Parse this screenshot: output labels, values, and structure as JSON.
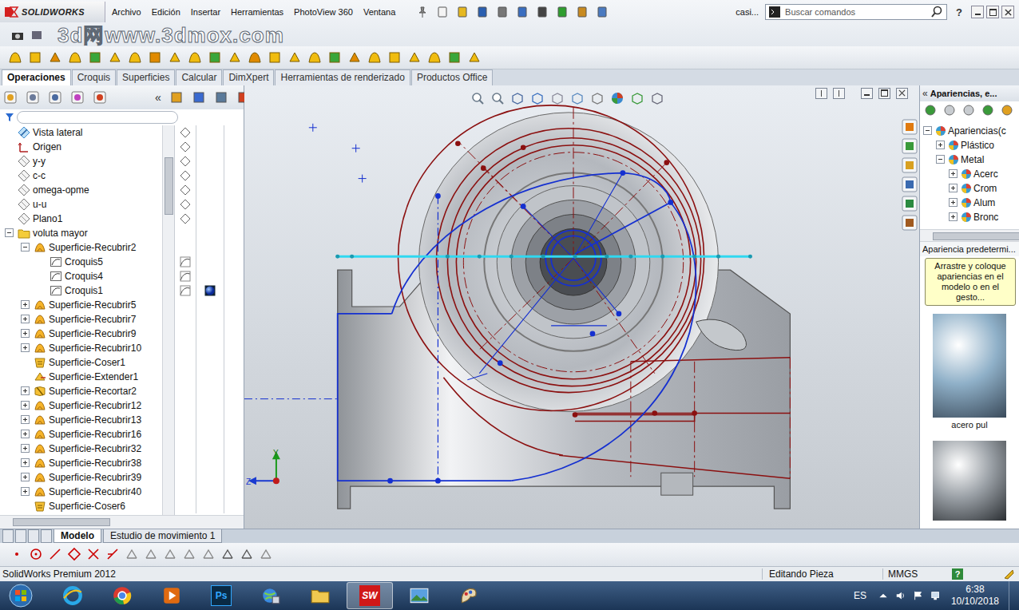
{
  "watermark": "3d网www.3dmox.com",
  "app": {
    "logo": "SOLIDWORKS",
    "menu": [
      "Archivo",
      "Edición",
      "Insertar",
      "Herramientas",
      "PhotoView 360",
      "Ventana"
    ],
    "document": "casi...",
    "search": {
      "placeholder": "Buscar comandos"
    },
    "help": "?"
  },
  "command_tabs": [
    {
      "label": "Operaciones",
      "selected": true
    },
    {
      "label": "Croquis",
      "selected": false
    },
    {
      "label": "Superficies",
      "selected": false
    },
    {
      "label": "Calcular",
      "selected": false
    },
    {
      "label": "DimXpert",
      "selected": false
    },
    {
      "label": "Herramientas de renderizado",
      "selected": false
    },
    {
      "label": "Productos Office",
      "selected": false
    }
  ],
  "feature_tree": {
    "collapse": "«",
    "items": [
      {
        "label": "Vista lateral",
        "kind": "view",
        "level": 0,
        "has_children": false,
        "expanded": false,
        "appearance": false
      },
      {
        "label": "Origen",
        "kind": "origin",
        "level": 0,
        "has_children": false,
        "expanded": false,
        "appearance": false
      },
      {
        "label": "y-y",
        "kind": "plane",
        "level": 0,
        "has_children": false,
        "expanded": false,
        "appearance": false
      },
      {
        "label": "c-c",
        "kind": "plane",
        "level": 0,
        "has_children": false,
        "expanded": false,
        "appearance": false
      },
      {
        "label": "omega-opme",
        "kind": "plane",
        "level": 0,
        "has_children": false,
        "expanded": false,
        "appearance": false
      },
      {
        "label": "u-u",
        "kind": "plane",
        "level": 0,
        "has_children": false,
        "expanded": false,
        "appearance": false
      },
      {
        "label": "Plano1",
        "kind": "plane",
        "level": 0,
        "has_children": false,
        "expanded": false,
        "appearance": false
      },
      {
        "label": "voluta mayor",
        "kind": "folder",
        "level": 0,
        "has_children": true,
        "expanded": true,
        "appearance": false
      },
      {
        "label": "Superficie-Recubrir2",
        "kind": "loft",
        "level": 1,
        "has_children": true,
        "expanded": true,
        "appearance": false
      },
      {
        "label": "Croquis5",
        "kind": "sketch",
        "level": 2,
        "has_children": false,
        "expanded": false,
        "appearance": false
      },
      {
        "label": "Croquis4",
        "kind": "sketch",
        "level": 2,
        "has_children": false,
        "expanded": false,
        "appearance": false
      },
      {
        "label": "Croquis1",
        "kind": "sketch",
        "level": 2,
        "has_children": false,
        "expanded": false,
        "appearance": true
      },
      {
        "label": "Superficie-Recubrir5",
        "kind": "loft",
        "level": 1,
        "has_children": true,
        "expanded": false,
        "appearance": false
      },
      {
        "label": "Superficie-Recubrir7",
        "kind": "loft",
        "level": 1,
        "has_children": true,
        "expanded": false,
        "appearance": false
      },
      {
        "label": "Superficie-Recubrir9",
        "kind": "loft",
        "level": 1,
        "has_children": true,
        "expanded": false,
        "appearance": false
      },
      {
        "label": "Superficie-Recubrir10",
        "kind": "loft",
        "level": 1,
        "has_children": true,
        "expanded": false,
        "appearance": false
      },
      {
        "label": "Superficie-Coser1",
        "kind": "knit",
        "level": 1,
        "has_children": false,
        "expanded": false,
        "appearance": false
      },
      {
        "label": "Superficie-Extender1",
        "kind": "extend",
        "level": 1,
        "has_children": false,
        "expanded": false,
        "appearance": false
      },
      {
        "label": "Superficie-Recortar2",
        "kind": "trim",
        "level": 1,
        "has_children": true,
        "expanded": false,
        "appearance": false
      },
      {
        "label": "Superficie-Recubrir12",
        "kind": "loft",
        "level": 1,
        "has_children": true,
        "expanded": false,
        "appearance": false
      },
      {
        "label": "Superficie-Recubrir13",
        "kind": "loft",
        "level": 1,
        "has_children": true,
        "expanded": false,
        "appearance": false
      },
      {
        "label": "Superficie-Recubrir16",
        "kind": "loft",
        "level": 1,
        "has_children": true,
        "expanded": false,
        "appearance": false
      },
      {
        "label": "Superficie-Recubrir32",
        "kind": "loft",
        "level": 1,
        "has_children": true,
        "expanded": false,
        "appearance": false
      },
      {
        "label": "Superficie-Recubrir38",
        "kind": "loft",
        "level": 1,
        "has_children": true,
        "expanded": false,
        "appearance": false
      },
      {
        "label": "Superficie-Recubrir39",
        "kind": "loft",
        "level": 1,
        "has_children": true,
        "expanded": false,
        "appearance": false
      },
      {
        "label": "Superficie-Recubrir40",
        "kind": "loft",
        "level": 1,
        "has_children": true,
        "expanded": false,
        "appearance": false
      },
      {
        "label": "Superficie-Coser6",
        "kind": "knit",
        "level": 1,
        "has_children": false,
        "expanded": false,
        "appearance": false
      }
    ]
  },
  "view": {
    "axes": {
      "y": "Y",
      "z": "Z"
    }
  },
  "bottom_tabs": [
    {
      "label": "Modelo",
      "selected": true
    },
    {
      "label": "Estudio de movimiento 1",
      "selected": false
    }
  ],
  "task_pane": {
    "collapse": "«",
    "title": "Apariencias, e...",
    "tree": [
      {
        "label": "Apariencias(c",
        "level": 0,
        "expanded": true
      },
      {
        "label": "Plástico",
        "level": 1,
        "expanded": false
      },
      {
        "label": "Metal",
        "level": 1,
        "expanded": true
      },
      {
        "label": "Acerc",
        "level": 2,
        "expanded": false
      },
      {
        "label": "Crom",
        "level": 2,
        "expanded": false
      },
      {
        "label": "Alum",
        "level": 2,
        "expanded": false
      },
      {
        "label": "Bronc",
        "level": 2,
        "expanded": false
      }
    ],
    "section": "Apariencia predetermi...",
    "tooltip": "Arrastre y coloque apariencias en el modelo o en el gesto...",
    "swatches": [
      {
        "label": "acero pul",
        "color": "#8fb0c8"
      }
    ]
  },
  "status_bar": {
    "product": "SolidWorks Premium 2012",
    "mode": "Editando Pieza",
    "units": "MMGS",
    "help": "?"
  },
  "taskbar": {
    "apps": [
      {
        "kind": "ie",
        "label": "",
        "active": false
      },
      {
        "kind": "chrome",
        "label": "",
        "active": false
      },
      {
        "kind": "media",
        "label": "",
        "active": false
      },
      {
        "kind": "photoshop",
        "label": "Ps",
        "active": false
      },
      {
        "kind": "globe",
        "label": "",
        "active": false
      },
      {
        "kind": "explorer",
        "label": "",
        "active": false
      },
      {
        "kind": "solidworks",
        "label": "SW",
        "active": true
      },
      {
        "kind": "photos",
        "label": "",
        "active": false
      },
      {
        "kind": "paint",
        "label": "",
        "active": false
      }
    ],
    "language": "ES",
    "time": "6:38",
    "date": "10/10/2018"
  }
}
